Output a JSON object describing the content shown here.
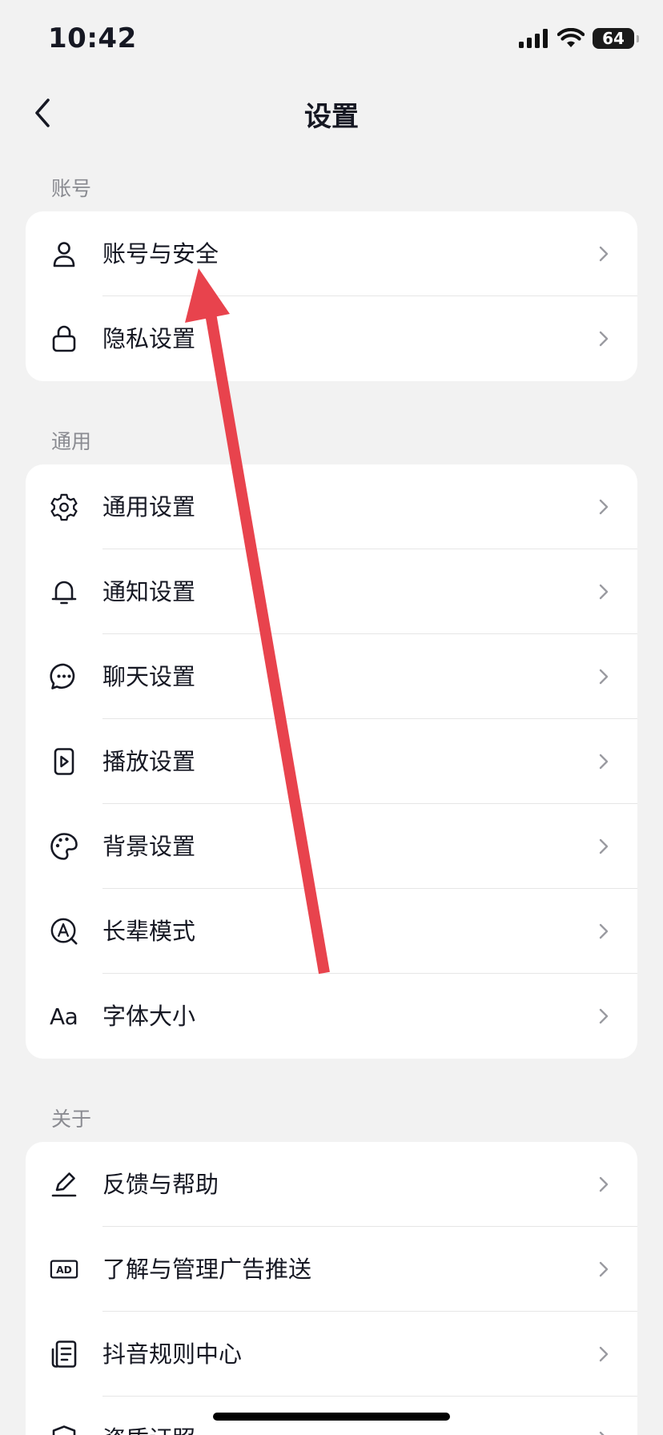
{
  "status_bar": {
    "time": "10:42",
    "battery": "64"
  },
  "nav": {
    "title": "设置"
  },
  "sections": {
    "account": {
      "title": "账号",
      "items": [
        {
          "label": "账号与安全",
          "icon": "person-icon"
        },
        {
          "label": "隐私设置",
          "icon": "lock-icon"
        }
      ]
    },
    "general": {
      "title": "通用",
      "items": [
        {
          "label": "通用设置",
          "icon": "gear-icon"
        },
        {
          "label": "通知设置",
          "icon": "bell-icon"
        },
        {
          "label": "聊天设置",
          "icon": "chat-bubble-icon"
        },
        {
          "label": "播放设置",
          "icon": "play-icon"
        },
        {
          "label": "背景设置",
          "icon": "palette-icon"
        },
        {
          "label": "长辈模式",
          "icon": "elder-mode-icon"
        },
        {
          "label": "字体大小",
          "icon": "font-size-icon",
          "icon_text": "Aa"
        }
      ]
    },
    "about": {
      "title": "关于",
      "items": [
        {
          "label": "反馈与帮助",
          "icon": "pen-icon"
        },
        {
          "label": "了解与管理广告推送",
          "icon": "ad-icon",
          "icon_text": "AD"
        },
        {
          "label": "抖音规则中心",
          "icon": "document-icon"
        },
        {
          "label": "资质证照",
          "icon": "shield-icon"
        }
      ]
    }
  },
  "annotation": {
    "type": "arrow",
    "color": "#e8434d",
    "target": "账号与安全"
  }
}
